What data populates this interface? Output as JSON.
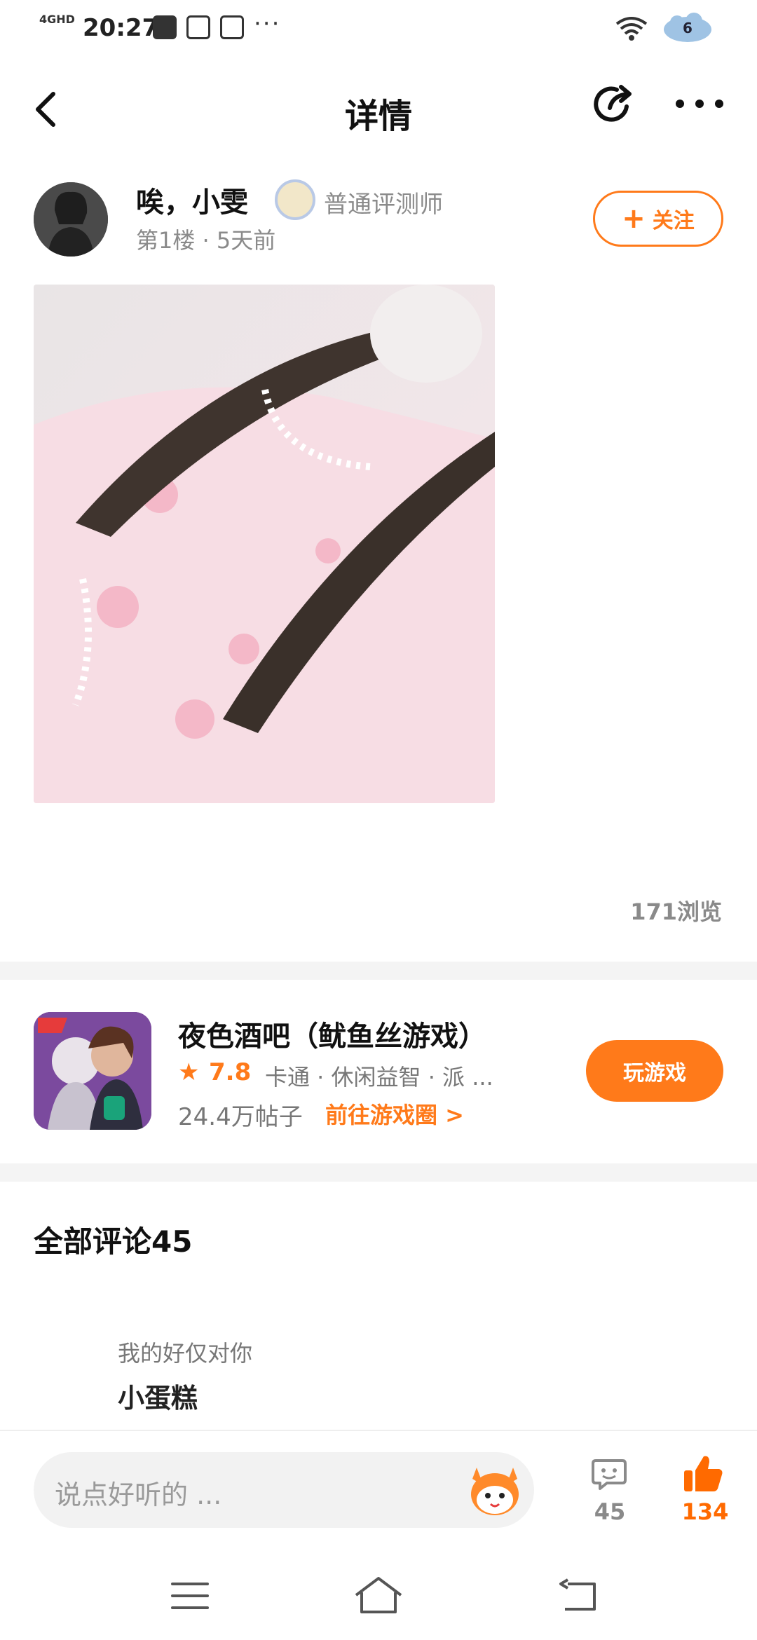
{
  "status_bar": {
    "network": "4GHD",
    "time": "20:27",
    "more": "···",
    "battery_level": "6"
  },
  "header": {
    "title": "详情"
  },
  "post": {
    "author_name": "唉，小雯",
    "author_badge": "普通评测师",
    "meta": "第1楼 · 5天前",
    "follow_label": "关注",
    "views": "171浏览"
  },
  "game": {
    "title": "夜色酒吧（鱿鱼丝游戏）",
    "rating": "7.8",
    "tags": "卡通 · 休闲益智 · 派 ...",
    "posts": "24.4万帖子",
    "link": "前往游戏圈 >",
    "play_label": "玩游戏"
  },
  "comments": {
    "title": "全部评论45",
    "items": [
      {
        "reply_text": "我的好仅对你",
        "user": "小蛋糕"
      }
    ]
  },
  "bottom_bar": {
    "placeholder": "说点好听的 ...",
    "comment_count": "45",
    "like_count": "134"
  },
  "colors": {
    "accent": "#ff7a1a",
    "like": "#ff6a00",
    "muted": "#8a8a8a"
  }
}
